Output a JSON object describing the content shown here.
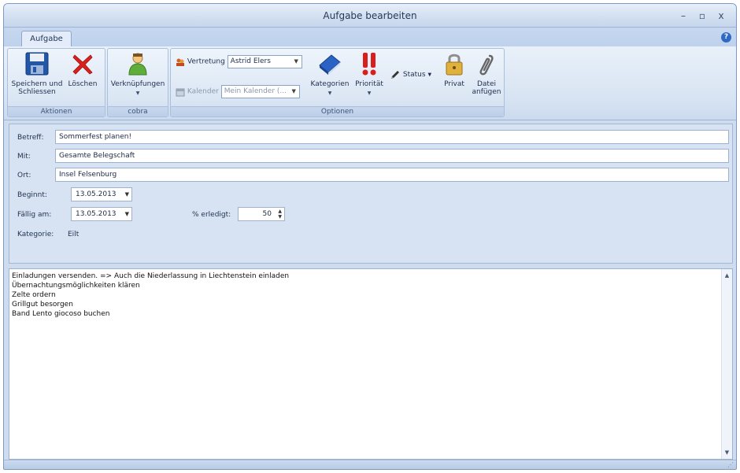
{
  "window": {
    "title": "Aufgabe bearbeiten",
    "minimize": "–",
    "maximize": "▫",
    "close": "x"
  },
  "tabs": [
    {
      "label": "Aufgabe",
      "active": true
    }
  ],
  "help_icon": "?",
  "ribbon": {
    "groups": {
      "aktionen": "Aktionen",
      "cobra": "cobra",
      "optionen": "Optionen"
    },
    "buttons": {
      "save_close_line1": "Speichern und",
      "save_close_line2": "Schliessen",
      "delete": "Löschen",
      "links": "Verknüpfungen",
      "categories": "Kategorien",
      "priority": "Priorität",
      "status": "Status",
      "private": "Privat",
      "attach_line1": "Datei",
      "attach_line2": "anfügen"
    },
    "vertretung_label": "Vertretung",
    "vertretung_value": "Astrid Elers",
    "kalender_label": "Kalender",
    "kalender_value": "Mein Kalender (..."
  },
  "form": {
    "betreff_label": "Betreff:",
    "betreff_value": "Sommerfest planen!",
    "mit_label": "Mit:",
    "mit_value": "Gesamte Belegschaft",
    "ort_label": "Ort:",
    "ort_value": "Insel Felsenburg",
    "beginnt_label": "Beginnt:",
    "beginnt_value": "13.05.2013",
    "faellig_label": "Fällig am:",
    "faellig_value": "13.05.2013",
    "erledigt_label": "% erledigt:",
    "erledigt_value": "50",
    "kategorie_label": "Kategorie:",
    "kategorie_value": "Eilt"
  },
  "notes": [
    "Einladungen versenden. => Auch die Niederlassung in Liechtenstein einladen",
    "Übernachtungsmöglichkeiten klären",
    "Zelte ordern",
    "Grillgut besorgen",
    "Band Lento giocoso buchen"
  ],
  "colors": {
    "accent": "#2e69c6",
    "ribbon": "#d8e4f3",
    "frame": "#cfdcee"
  },
  "icons": {
    "save": "floppy-disk-icon",
    "delete": "red-x-icon",
    "links": "person-icon",
    "categories": "blue-book-icon",
    "priority": "exclamation-icon",
    "status": "pen-icon",
    "private": "padlock-icon",
    "attach": "paperclip-icon"
  }
}
